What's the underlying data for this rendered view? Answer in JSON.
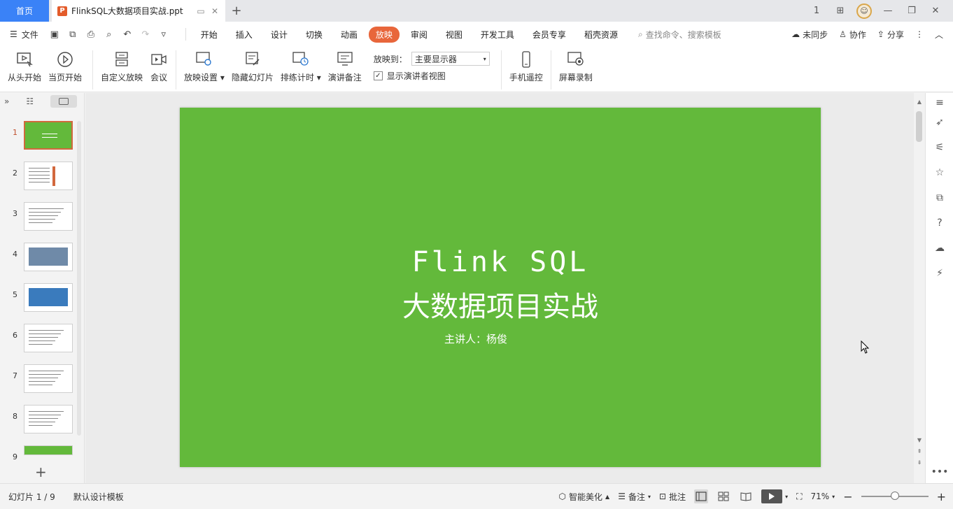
{
  "titlebar": {
    "home_tab": "首页",
    "doc_tab_title": "FlinkSQL大数据项目实战.ppt",
    "doc_badge": "P",
    "new_tab": "+",
    "page_indicator": "1"
  },
  "menubar": {
    "file": "文件",
    "tabs": [
      "开始",
      "插入",
      "设计",
      "切换",
      "动画",
      "放映",
      "审阅",
      "视图",
      "开发工具",
      "会员专享",
      "稻壳资源"
    ],
    "active_tab": "放映",
    "search_placeholder": "查找命令、搜索模板",
    "sync": "未同步",
    "collab": "协作",
    "share": "分享"
  },
  "ribbon": {
    "from_start": "从头开始",
    "from_current": "当页开始",
    "custom_show": "自定义放映",
    "meeting": "会议",
    "show_settings": "放映设置",
    "hide_slide": "隐藏幻灯片",
    "rehearse": "排练计时",
    "speaker_notes": "演讲备注",
    "show_to_label": "放映到：",
    "show_to_value": "主要显示器",
    "presenter_view": "显示演讲者视图",
    "presenter_view_checked": true,
    "phone_remote": "手机遥控",
    "screen_record": "屏幕录制"
  },
  "slides": {
    "numbers": [
      "1",
      "2",
      "3",
      "4",
      "5",
      "6",
      "7",
      "8",
      "9"
    ],
    "selected": 1
  },
  "slide": {
    "title_line1": "Flink SQL",
    "title_line2": "大数据项目实战",
    "speaker": "主讲人：杨俊",
    "background": "#63b93b"
  },
  "statusbar": {
    "slide_count": "幻灯片 1 / 9",
    "template": "默认设计模板",
    "beautify": "智能美化",
    "notes": "备注",
    "comments": "批注",
    "zoom": "71%"
  },
  "colors": {
    "accent": "#e8663b",
    "home_tab": "#3a82f7"
  }
}
